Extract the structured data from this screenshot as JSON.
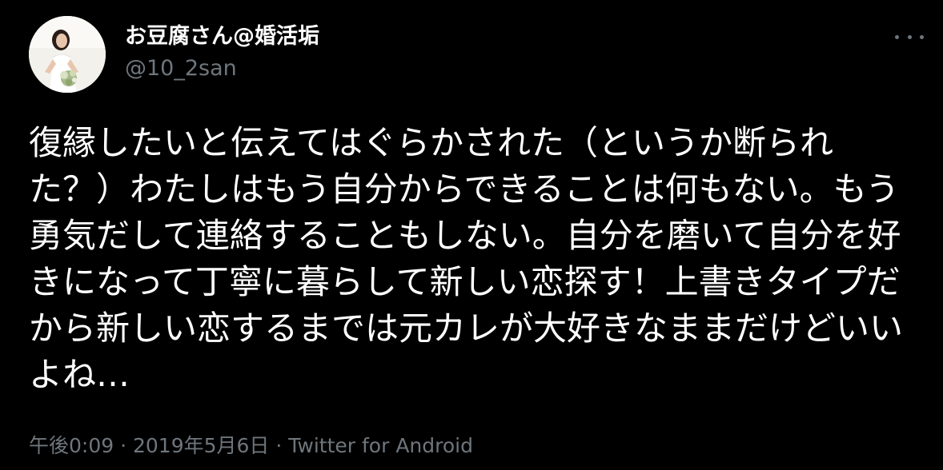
{
  "author": {
    "display_name": "お豆腐さん@婚活垢",
    "handle": "@10_2san"
  },
  "tweet": {
    "text": "復縁したいと伝えてはぐらかされた（というか断られた？）わたしはもう自分からできることは何もない。もう勇気だして連絡することもしない。自分を磨いて自分を好きになって丁寧に暮らして新しい恋探す！上書きタイプだから新しい恋するまでは元カレが大好きなままだけどいいよね…"
  },
  "meta": {
    "time": "午後0:09",
    "separator_1": " · ",
    "date": "2019年5月6日",
    "separator_2": " · ",
    "source": "Twitter for Android"
  },
  "icons": {
    "more": "more-horizontal-icon",
    "avatar": "profile-photo"
  },
  "colors": {
    "background": "#000000",
    "primary_text": "#ffffff",
    "secondary_text": "#6e767d"
  }
}
